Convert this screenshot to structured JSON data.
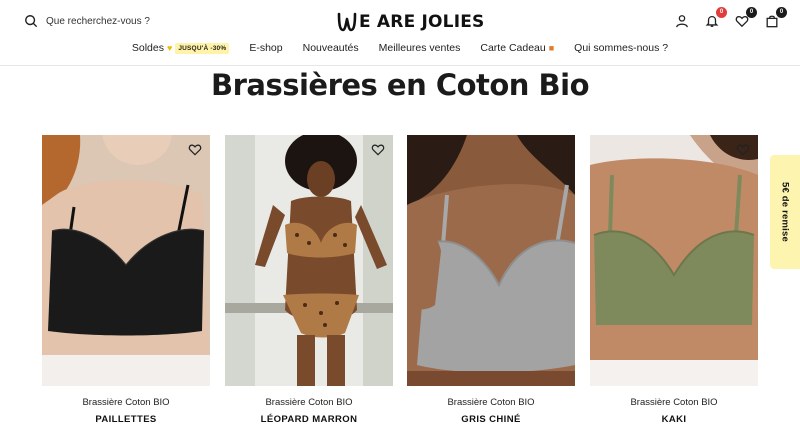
{
  "header": {
    "search_placeholder": "Que recherchez-vous ?",
    "logo_text": "E ARE JOLIES",
    "badges": {
      "notifications": "0",
      "wishlist": "0",
      "cart": "0"
    }
  },
  "nav": {
    "soldes": "Soldes",
    "soldes_tag": "JUSQU'À -30%",
    "eshop": "E-shop",
    "nouveautes": "Nouveautés",
    "meilleures_ventes": "Meilleures ventes",
    "carte_cadeau": "Carte Cadeau",
    "qui_sommes_nous": "Qui sommes-nous ?"
  },
  "page_title": "Brassières en Coton Bio",
  "products": [
    {
      "name": "Brassière Coton BIO",
      "variant": "PAILLETTES"
    },
    {
      "name": "Brassière Coton BIO",
      "variant": "LÉOPARD MARRON"
    },
    {
      "name": "Brassière Coton BIO",
      "variant": "GRIS CHINÉ"
    },
    {
      "name": "Brassière Coton BIO",
      "variant": "KAKI"
    }
  ],
  "side_tab": "5€ de remise",
  "colors": {
    "accent_yellow": "#fdf4b0",
    "badge_red": "#e23d3d",
    "text_dark": "#1c1b1b"
  }
}
